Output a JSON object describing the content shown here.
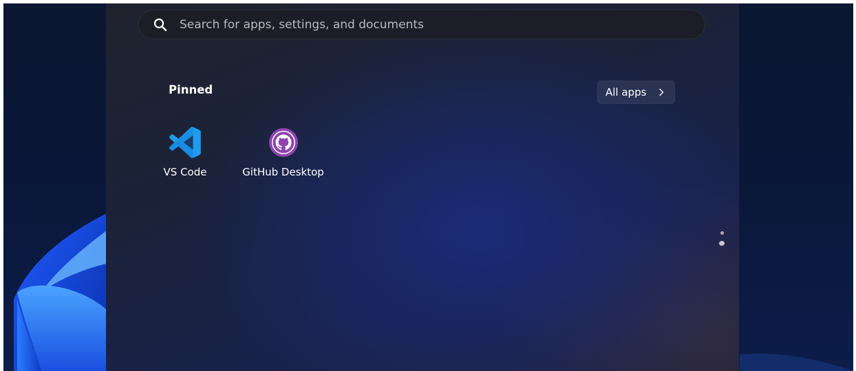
{
  "search": {
    "placeholder": "Search for apps, settings, and documents",
    "icon": "search-icon"
  },
  "pinned": {
    "title": "Pinned",
    "all_apps_label": "All apps",
    "all_apps_icon": "chevron-right-icon",
    "apps": [
      {
        "label": "VS Code",
        "icon": "vscode-icon",
        "color": "#23a9f2"
      },
      {
        "label": "GitHub Desktop",
        "icon": "github-desktop-icon",
        "color": "#8e44ad"
      }
    ]
  },
  "pagination": {
    "pages": 2,
    "current": 2
  },
  "colors": {
    "panel": "#1d2338",
    "desktop": "#0a1738",
    "accent": "#2f7dff"
  }
}
